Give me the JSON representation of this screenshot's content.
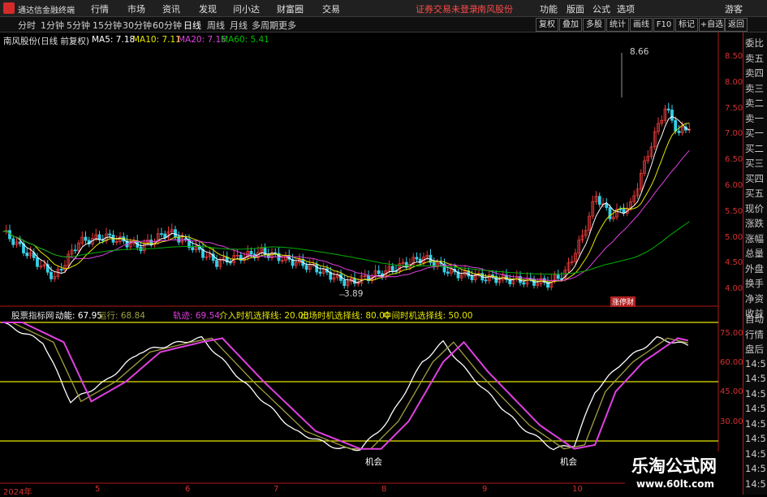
{
  "menubar": {
    "app_title": "通达信金融终端",
    "items": [
      "行情",
      "市场",
      "资讯",
      "发现",
      "问小达",
      "财富圈",
      "交易"
    ],
    "notice": "证券交易未登录",
    "stock": "南风股份",
    "right_items": [
      "功能",
      "版面",
      "公式",
      "选项"
    ],
    "guest": "游客"
  },
  "toolbar": {
    "periods": [
      "分时",
      "1分钟",
      "5分钟",
      "15分钟",
      "30分钟",
      "60分钟",
      "日线",
      "周线",
      "月线",
      "多周期",
      "更多"
    ],
    "active": "日线",
    "right_buttons": [
      "复权",
      "叠加",
      "多股",
      "统计",
      "画线",
      "F10",
      "标记",
      "+自选",
      "返回"
    ]
  },
  "main_legend": {
    "stock": "南风股份(日线 前复权)",
    "ma5": "MA5: 7.18",
    "ma10": "MA10: 7.11",
    "ma20": "MA20: 7.16",
    "ma60": "MA60: 5.41"
  },
  "annotations": {
    "high": "8.66",
    "low": "3.89",
    "tag": "涨停财"
  },
  "indicator_legend": {
    "name": "股票指标网",
    "dongneng": "动能: 67.95",
    "yunxing": "运行: 68.84",
    "guiji": "轨迹: 69.54",
    "buy_line": "介入时机选择线: 20.00",
    "sell_line": "出场时机选择线: 80.00",
    "mid_line": "中间时机选择线: 50.00"
  },
  "signals": [
    "机会",
    "机会"
  ],
  "price_axis": [
    "8.50",
    "8.00",
    "7.50",
    "7.00",
    "6.50",
    "6.00",
    "5.50",
    "5.00",
    "4.50",
    "4.00"
  ],
  "ind_axis": [
    "75.00",
    "60.00",
    "45.00",
    "30.00"
  ],
  "dates": [
    "2024年",
    "5",
    "6",
    "7",
    "8",
    "9",
    "10"
  ],
  "side_panel": [
    "委比",
    "卖五",
    "卖四",
    "卖三",
    "卖二",
    "卖一",
    "买一",
    "买二",
    "买三",
    "买四",
    "买五",
    "现价",
    "涨跌",
    "涨幅",
    "总量",
    "外盘",
    "换手",
    "净资",
    "收益"
  ],
  "side_panel_bottom": [
    "自动",
    "行情",
    "盘后",
    "14:5",
    "14:5",
    "14:5",
    "14:5",
    "14:5",
    "14:5",
    "14:5",
    "14:5",
    "14:5"
  ],
  "watermark": {
    "title": "乐淘公式网",
    "url": "www.60lt.com"
  },
  "colors": {
    "up": "#e83a3a",
    "down": "#35d0e8",
    "ma5": "#ffffff",
    "ma10": "#e6e600",
    "ma20": "#e040e0",
    "ma60": "#00b000"
  }
}
